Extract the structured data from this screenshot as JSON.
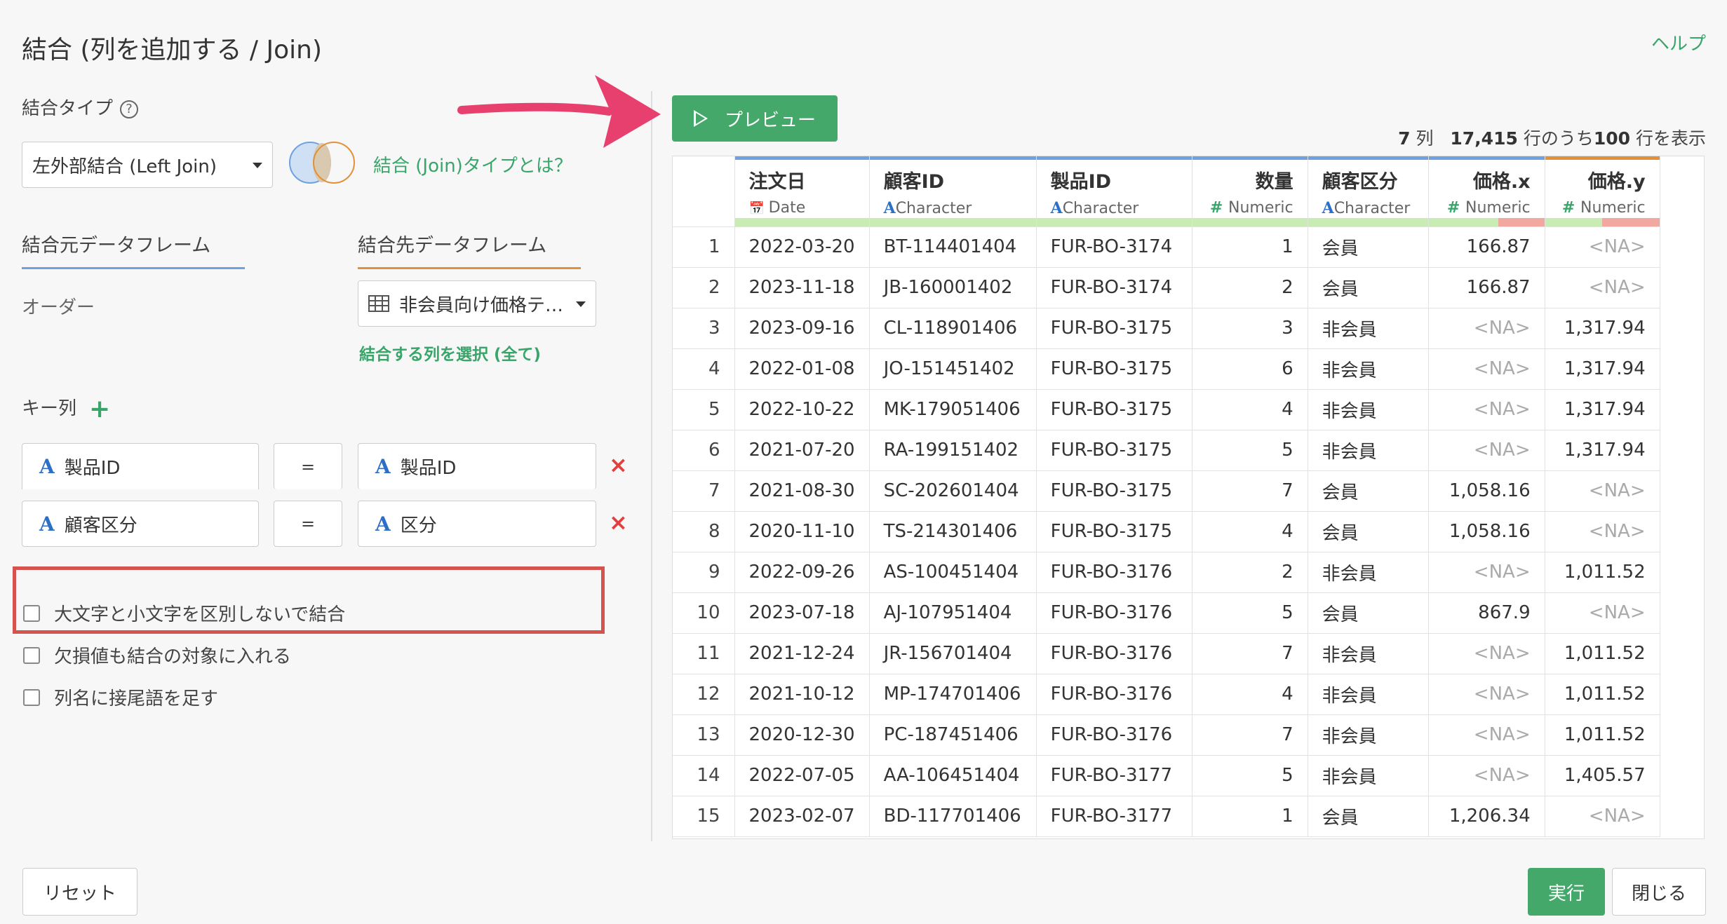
{
  "dialog": {
    "title": "結合 (列を追加する / Join)",
    "help_link": "ヘルプ"
  },
  "join_type": {
    "label": "結合タイプ",
    "help_icon": "?",
    "selected": "左外部結合 (Left Join)",
    "about_link": "結合 (Join)タイプとは？"
  },
  "tabs": {
    "source": "結合元データフレーム",
    "target": "結合先データフレーム"
  },
  "source_df": "オーダー",
  "target_df": {
    "selected": "非会員向け価格テ…",
    "select_columns_link": "結合する列を選択 (全て)"
  },
  "key_columns": {
    "label": "キー列",
    "add_icon": "+",
    "pairs": [
      {
        "left": "製品ID",
        "eq": "=",
        "right": "製品ID",
        "delete": "×"
      },
      {
        "left": "顧客区分",
        "eq": "=",
        "right": "区分",
        "delete": "×"
      }
    ]
  },
  "options": [
    "大文字と小文字を区別しないで結合",
    "欠損値も結合の対象に入れる",
    "列名に接尾語を足す"
  ],
  "preview": {
    "button": "プレビュー",
    "cols": "7",
    "cols_unit": "列",
    "total_rows": "17,415",
    "rows_mid": "行のうち",
    "shown_rows": "100",
    "rows_tail": "行を表示"
  },
  "table": {
    "columns": [
      {
        "name": "注文日",
        "type": "Date",
        "icon": "calendar-icon",
        "align": "left",
        "topbar": "#6fa0e0"
      },
      {
        "name": "顧客ID",
        "type": "Character",
        "icon": "character-icon",
        "align": "left",
        "topbar": "#6fa0e0"
      },
      {
        "name": "製品ID",
        "type": "Character",
        "icon": "character-icon",
        "align": "left",
        "topbar": "#6fa0e0"
      },
      {
        "name": "数量",
        "type": "Numeric",
        "icon": "numeric-icon",
        "align": "right",
        "topbar": "#6fa0e0"
      },
      {
        "name": "顧客区分",
        "type": "Character",
        "icon": "character-icon",
        "align": "left",
        "topbar": "#6fa0e0"
      },
      {
        "name": "価格.x",
        "type": "Numeric",
        "icon": "numeric-icon",
        "align": "right",
        "topbar": "#6fa0e0"
      },
      {
        "name": "価格.y",
        "type": "Numeric",
        "icon": "numeric-icon",
        "align": "right",
        "topbar": "#e0913a"
      }
    ],
    "missing_fraction": [
      0,
      0,
      0,
      0,
      0,
      0.4,
      0.5
    ],
    "rows": [
      [
        "1",
        "2022-03-20",
        "BT-114401404",
        "FUR-BO-3174",
        "1",
        "会員",
        "166.87",
        "<NA>"
      ],
      [
        "2",
        "2023-11-18",
        "JB-160001402",
        "FUR-BO-3174",
        "2",
        "会員",
        "166.87",
        "<NA>"
      ],
      [
        "3",
        "2023-09-16",
        "CL-118901406",
        "FUR-BO-3175",
        "3",
        "非会員",
        "<NA>",
        "1,317.94"
      ],
      [
        "4",
        "2022-01-08",
        "JO-151451402",
        "FUR-BO-3175",
        "6",
        "非会員",
        "<NA>",
        "1,317.94"
      ],
      [
        "5",
        "2022-10-22",
        "MK-179051406",
        "FUR-BO-3175",
        "4",
        "非会員",
        "<NA>",
        "1,317.94"
      ],
      [
        "6",
        "2021-07-20",
        "RA-199151402",
        "FUR-BO-3175",
        "5",
        "非会員",
        "<NA>",
        "1,317.94"
      ],
      [
        "7",
        "2021-08-30",
        "SC-202601404",
        "FUR-BO-3175",
        "7",
        "会員",
        "1,058.16",
        "<NA>"
      ],
      [
        "8",
        "2020-11-10",
        "TS-214301406",
        "FUR-BO-3175",
        "4",
        "会員",
        "1,058.16",
        "<NA>"
      ],
      [
        "9",
        "2022-09-26",
        "AS-100451404",
        "FUR-BO-3176",
        "2",
        "非会員",
        "<NA>",
        "1,011.52"
      ],
      [
        "10",
        "2023-07-18",
        "AJ-107951404",
        "FUR-BO-3176",
        "5",
        "会員",
        "867.9",
        "<NA>"
      ],
      [
        "11",
        "2021-12-24",
        "JR-156701404",
        "FUR-BO-3176",
        "7",
        "非会員",
        "<NA>",
        "1,011.52"
      ],
      [
        "12",
        "2021-10-12",
        "MP-174701406",
        "FUR-BO-3176",
        "4",
        "非会員",
        "<NA>",
        "1,011.52"
      ],
      [
        "13",
        "2020-12-30",
        "PC-187451406",
        "FUR-BO-3176",
        "7",
        "非会員",
        "<NA>",
        "1,011.52"
      ],
      [
        "14",
        "2022-07-05",
        "AA-106451404",
        "FUR-BO-3177",
        "5",
        "非会員",
        "<NA>",
        "1,405.57"
      ],
      [
        "15",
        "2023-02-07",
        "BD-117701406",
        "FUR-BO-3177",
        "1",
        "会員",
        "1,206.34",
        "<NA>"
      ]
    ]
  },
  "footer": {
    "reset": "リセット",
    "run": "実行",
    "close": "閉じる"
  },
  "colors": {
    "accent_green": "#45a86b",
    "source_blue": "#6fa0e0",
    "target_orange": "#e0913a",
    "highlight_red": "#d4534f",
    "arrow_pink": "#e8406e"
  }
}
